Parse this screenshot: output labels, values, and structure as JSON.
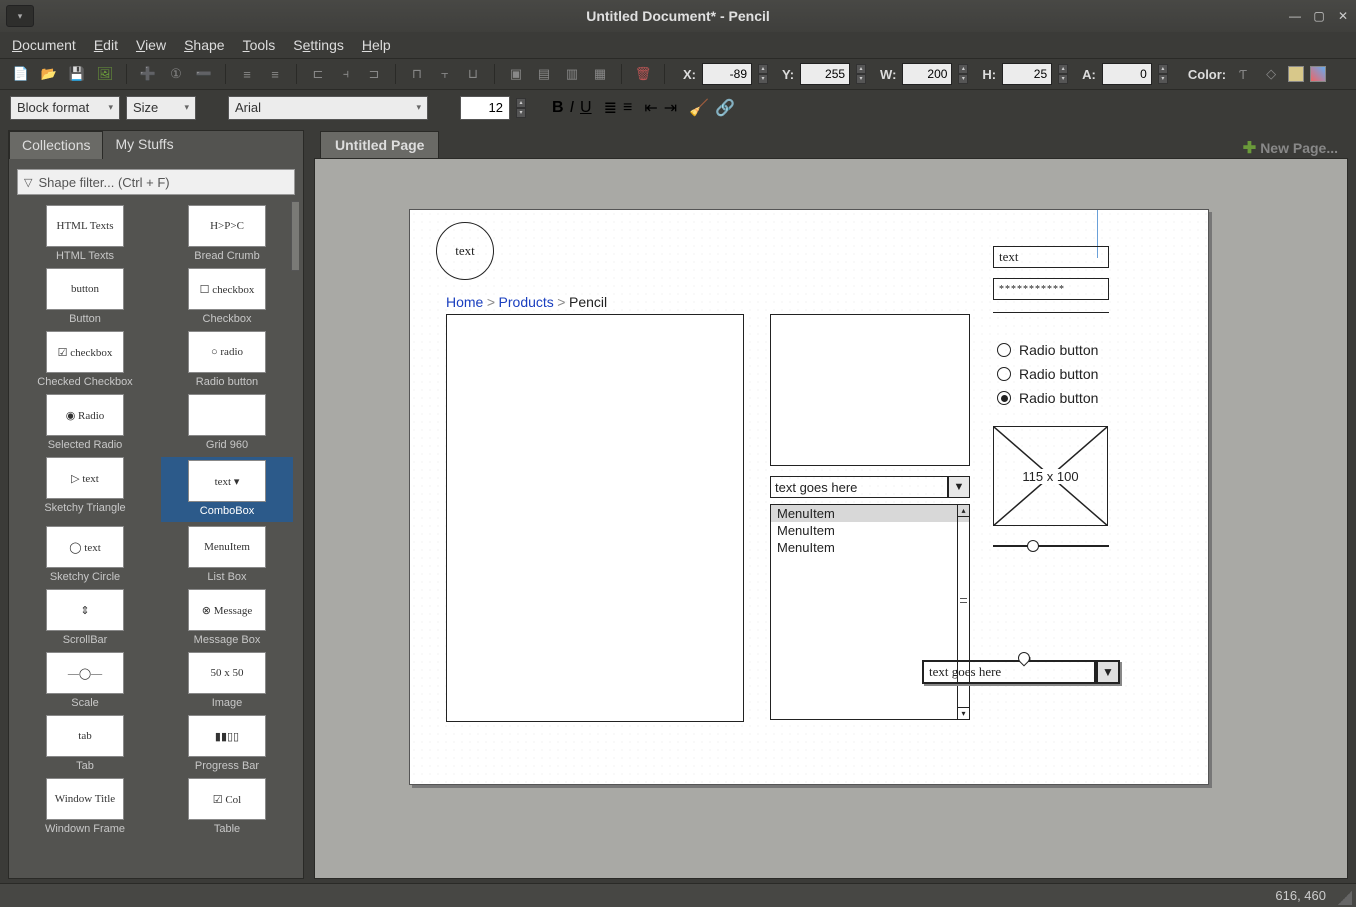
{
  "window": {
    "title": "Untitled Document* - Pencil"
  },
  "menu": {
    "document": "Document",
    "edit": "Edit",
    "view": "View",
    "shape": "Shape",
    "tools": "Tools",
    "settings": "Settings",
    "help": "Help"
  },
  "toolbar": {
    "x_label": "X:",
    "x": "-89",
    "y_label": "Y:",
    "y": "255",
    "w_label": "W:",
    "w": "200",
    "h_label": "H:",
    "h": "25",
    "a_label": "A:",
    "a": "0",
    "color_label": "Color:"
  },
  "toolbar2": {
    "block_format": "Block format",
    "size": "Size",
    "font": "Arial",
    "font_size": "12"
  },
  "sidebar": {
    "tabs": {
      "collections": "Collections",
      "mystuffs": "My Stuffs"
    },
    "filter_placeholder": "Shape filter... (Ctrl + F)",
    "items": [
      {
        "label": "HTML Texts",
        "thumb": "HTML Texts"
      },
      {
        "label": "Bread Crumb",
        "thumb": "H>P>C"
      },
      {
        "label": "Button",
        "thumb": "button"
      },
      {
        "label": "Checkbox",
        "thumb": "☐ checkbox"
      },
      {
        "label": "Checked Checkbox",
        "thumb": "☑ checkbox"
      },
      {
        "label": "Radio button",
        "thumb": "○ radio"
      },
      {
        "label": "Selected Radio",
        "thumb": "◉ Radio"
      },
      {
        "label": "Grid 960",
        "thumb": ""
      },
      {
        "label": "Sketchy Triangle",
        "thumb": "▷ text"
      },
      {
        "label": "ComboBox",
        "thumb": "text ▾"
      },
      {
        "label": "Sketchy Circle",
        "thumb": "◯ text"
      },
      {
        "label": "List Box",
        "thumb": "MenuItem"
      },
      {
        "label": "ScrollBar",
        "thumb": "⇕"
      },
      {
        "label": "Message Box",
        "thumb": "⊗ Message"
      },
      {
        "label": "Scale",
        "thumb": "—◯—"
      },
      {
        "label": "Image",
        "thumb": "50 x 50"
      },
      {
        "label": "Tab",
        "thumb": "tab"
      },
      {
        "label": "Progress Bar",
        "thumb": "▮▮▯▯"
      },
      {
        "label": "Windown Frame",
        "thumb": "Window Title"
      },
      {
        "label": "Table",
        "thumb": "☑ Col"
      }
    ],
    "selected_index": 9
  },
  "canvas": {
    "tab": "Untitled Page",
    "newpage": "New Page...",
    "circle_text": "text",
    "breadcrumb": {
      "home": "Home",
      "products": "Products",
      "current": "Pencil"
    },
    "combo1": "text goes here",
    "list_items": [
      "MenuItem",
      "MenuItem",
      "MenuItem"
    ],
    "textfield": "text",
    "password": "***********",
    "radios": [
      "Radio button",
      "Radio button",
      "Radio button"
    ],
    "radio_selected": 2,
    "image_label": "115 x 100",
    "float_combo": "text goes here"
  },
  "status": {
    "coords": "616, 460"
  }
}
